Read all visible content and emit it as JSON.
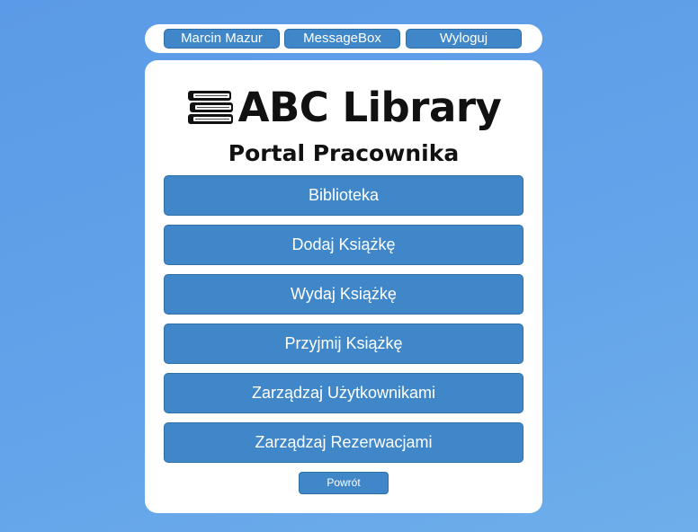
{
  "topbar": {
    "user_label": "Marcin Mazur",
    "messages_label": "MessageBox",
    "logout_label": "Wyloguj"
  },
  "header": {
    "logo_icon": "books-stack-icon",
    "title": "ABC Library",
    "subtitle": "Portal Pracownika"
  },
  "menu": {
    "items": [
      {
        "label": "Biblioteka"
      },
      {
        "label": "Dodaj Książkę"
      },
      {
        "label": "Wydaj Książkę"
      },
      {
        "label": "Przyjmij Książkę"
      },
      {
        "label": "Zarządzaj Użytkownikami"
      },
      {
        "label": "Zarządzaj Rezerwacjami"
      }
    ]
  },
  "footer": {
    "back_label": "Powrót"
  },
  "colors": {
    "background": "#5b9ae6",
    "button": "#3f87c8",
    "button_border": "#2f6fa8",
    "panel": "#ffffff",
    "text_dark": "#111111"
  }
}
